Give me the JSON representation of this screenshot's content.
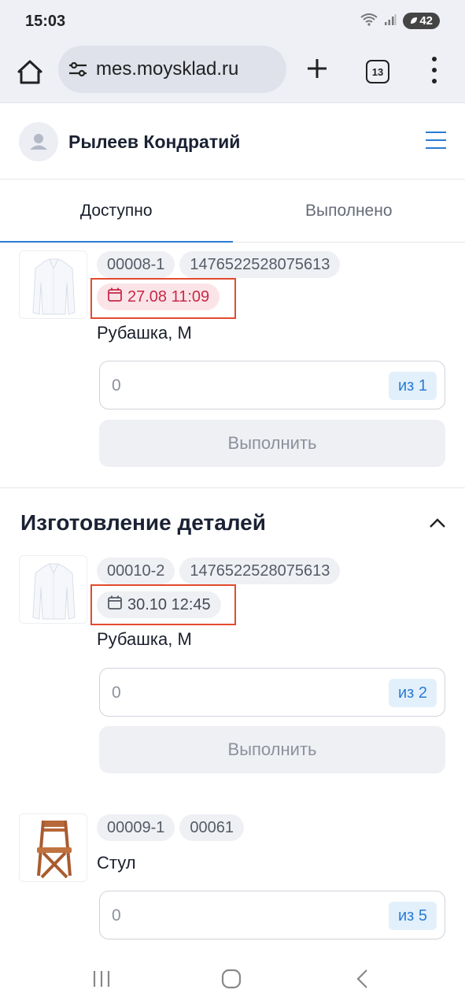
{
  "status_bar": {
    "time": "15:03",
    "battery": "42"
  },
  "browser": {
    "url": "mes.moysklad.ru",
    "tabs_count": "13"
  },
  "header": {
    "user_name": "Рылеев Кондратий"
  },
  "tabs": [
    {
      "label": "Доступно",
      "active": true
    },
    {
      "label": "Выполнено",
      "active": false
    }
  ],
  "items": [
    {
      "order": "00008-1",
      "code": "1476522528075613",
      "date": "27.08 11:09",
      "date_state": "overdue",
      "product": "Рубашка, M",
      "qty_value": "0",
      "qty_total": "из 1",
      "action": "Выполнить"
    }
  ],
  "section": {
    "title": "Изготовление деталей",
    "items": [
      {
        "order": "00010-2",
        "code": "1476522528075613",
        "date": "30.10 12:45",
        "date_state": "normal",
        "product": "Рубашка, M",
        "qty_value": "0",
        "qty_total": "из 2",
        "action": "Выполнить"
      },
      {
        "order": "00009-1",
        "code": "00061",
        "product": "Стул",
        "qty_value": "0",
        "qty_total": "из 5"
      }
    ]
  },
  "colors": {
    "accent": "#2b7bd3",
    "overdue": "#c8294a",
    "highlight": "#e34a2f"
  },
  "icons": [
    "home-icon",
    "site-settings-icon",
    "plus-icon",
    "tabs-icon",
    "more-icon",
    "user-icon",
    "menu-icon",
    "calendar-icon",
    "chevron-up-icon",
    "recents-icon",
    "home-nav-icon",
    "back-icon"
  ]
}
